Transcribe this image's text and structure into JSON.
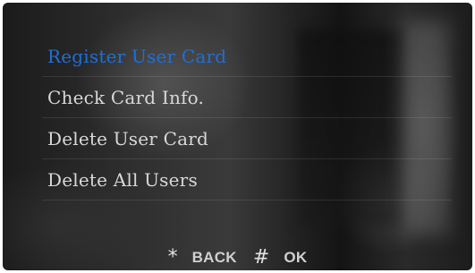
{
  "menu": {
    "items": [
      {
        "label": "Register User Card",
        "selected": true
      },
      {
        "label": "Check Card Info."
      },
      {
        "label": "Delete User Card"
      },
      {
        "label": "Delete All Users"
      }
    ]
  },
  "footer": {
    "back": {
      "icon": "*",
      "icon_name": "asterisk-icon",
      "label": "BACK"
    },
    "ok": {
      "icon": "#",
      "icon_name": "hash-icon",
      "label": "OK"
    }
  },
  "colors": {
    "selected": "#1f6fd8",
    "text": "#d8d8d8"
  }
}
